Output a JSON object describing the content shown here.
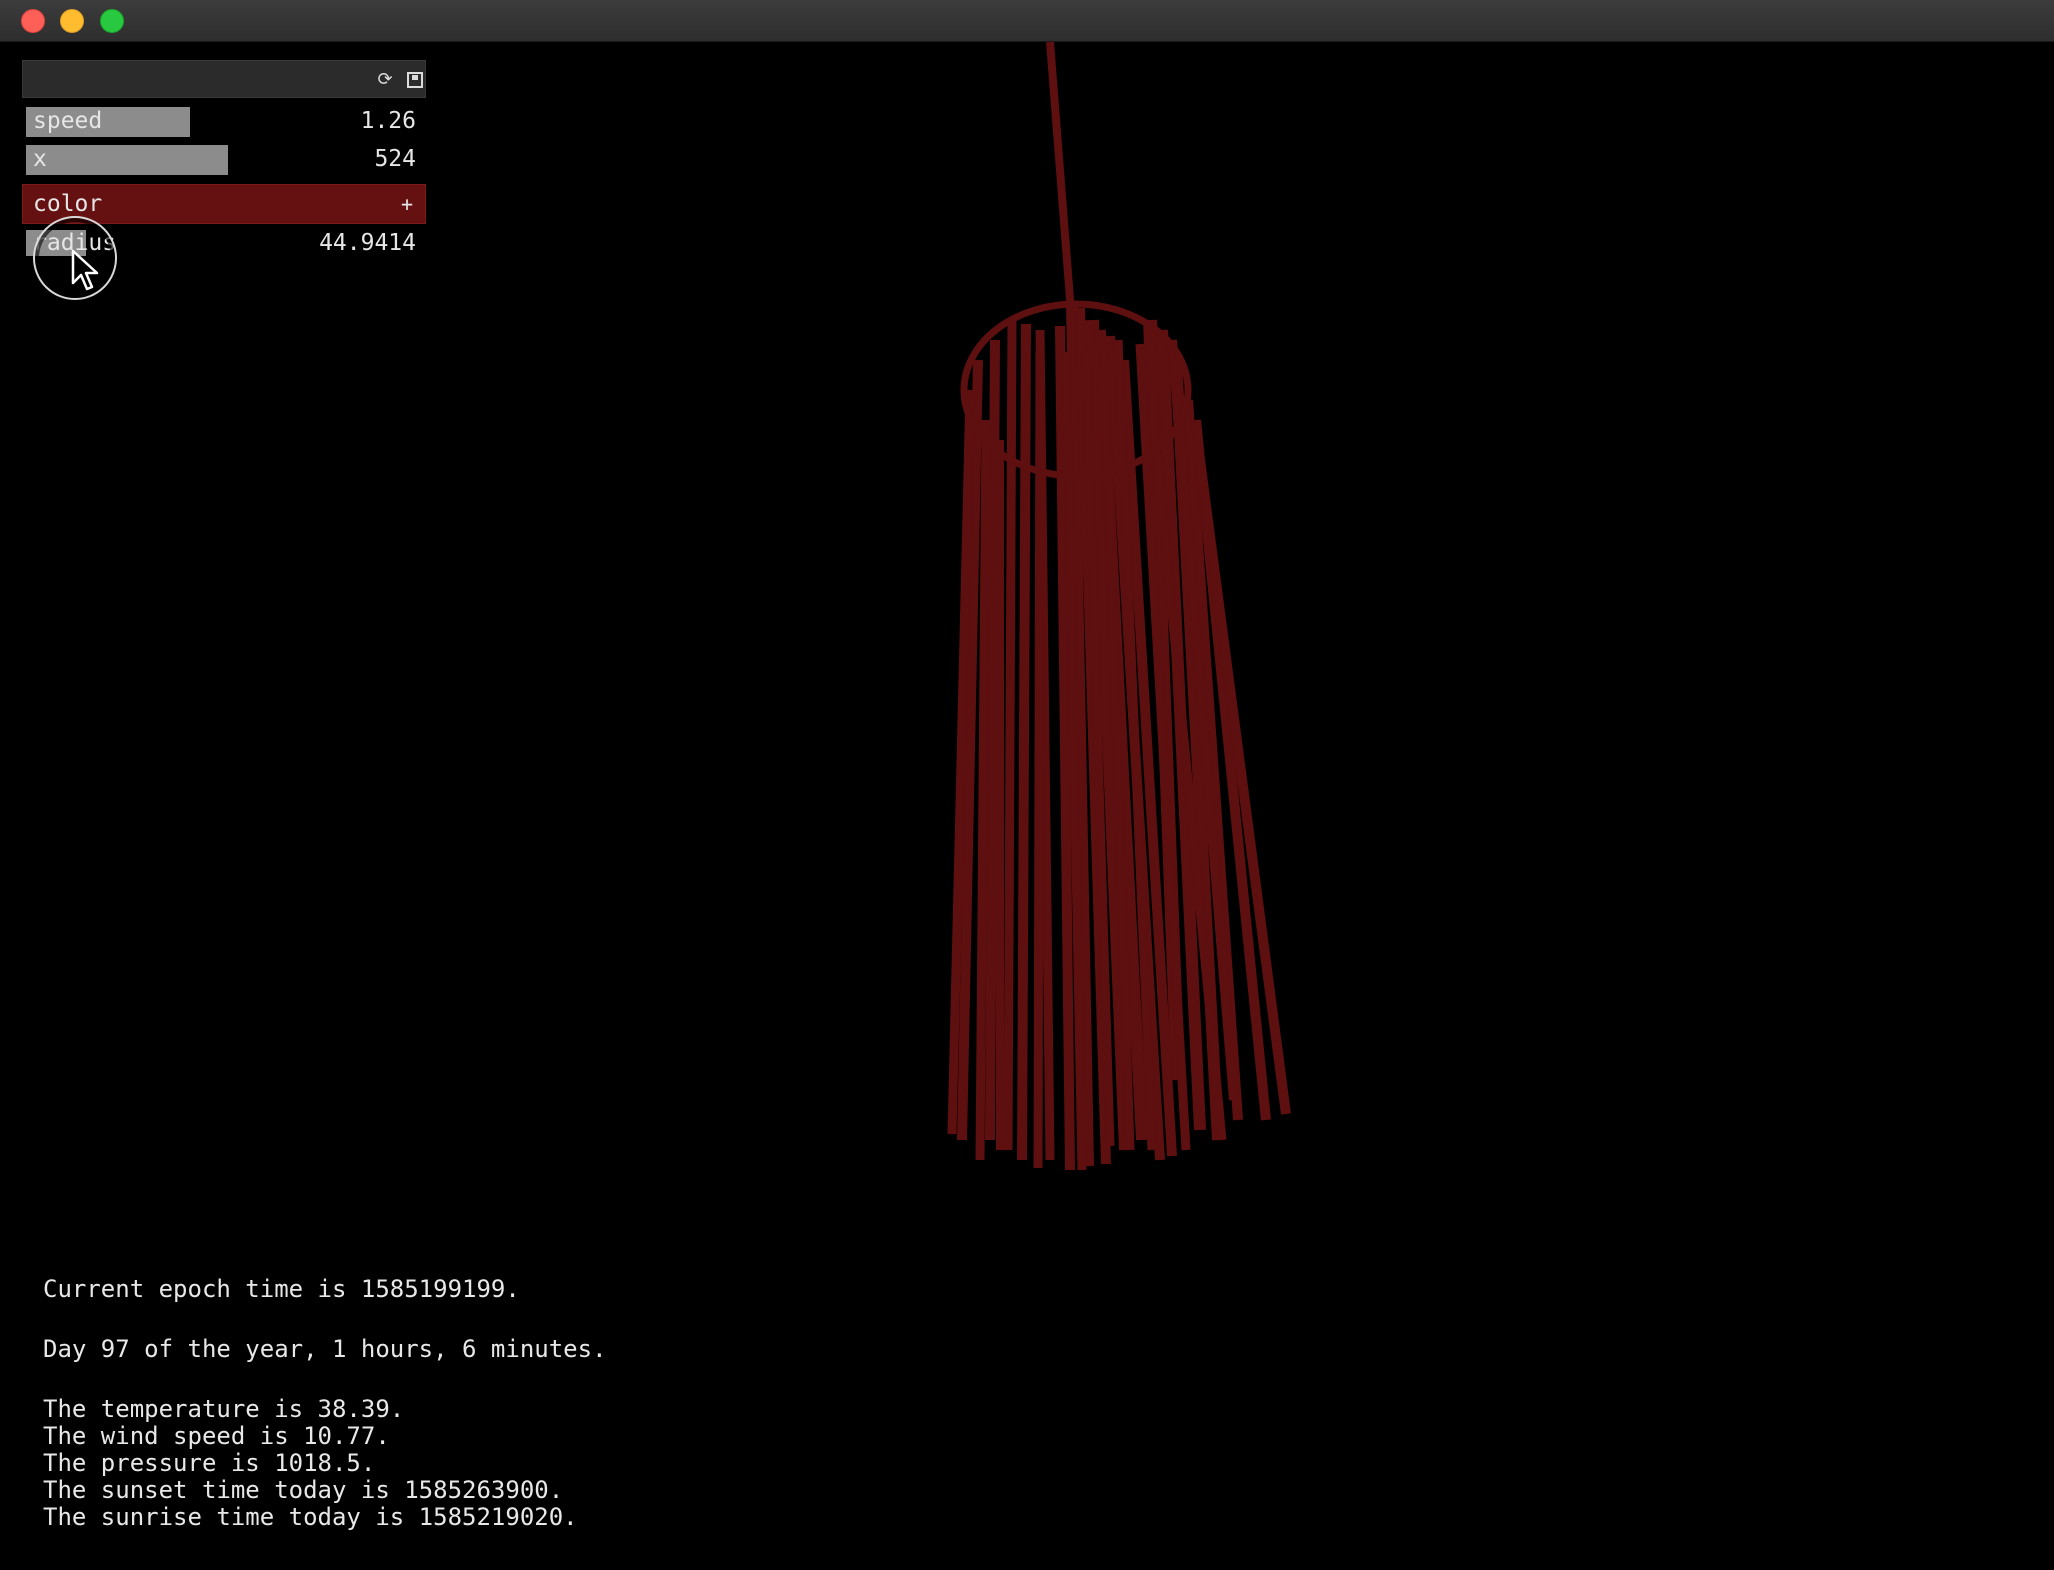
{
  "gui": {
    "sliders": [
      {
        "label": "speed",
        "value": "1.26",
        "fill": 0.42
      },
      {
        "label": "x",
        "value": "524",
        "fill": 0.51
      },
      {
        "label": "radius",
        "value": "44.9414",
        "fill": 0.15
      }
    ],
    "color": {
      "label": "color",
      "expand": "+",
      "swatch": "#661111"
    }
  },
  "icons": {
    "reload": "reload-icon",
    "save": "save-icon"
  },
  "sculpture_color": "#5e0f0f",
  "info": {
    "epoch": "Current epoch time is 1585199199.",
    "day": "Day 97 of the year, 1 hours, 6 minutes.",
    "temperature": "The temperature is 38.39.",
    "wind": "The wind speed is 10.77.",
    "pressure": "The pressure is 1018.5.",
    "sunset": "The sunset time today is 1585263900.",
    "sunrise": "The sunrise time today is 1585219020."
  }
}
